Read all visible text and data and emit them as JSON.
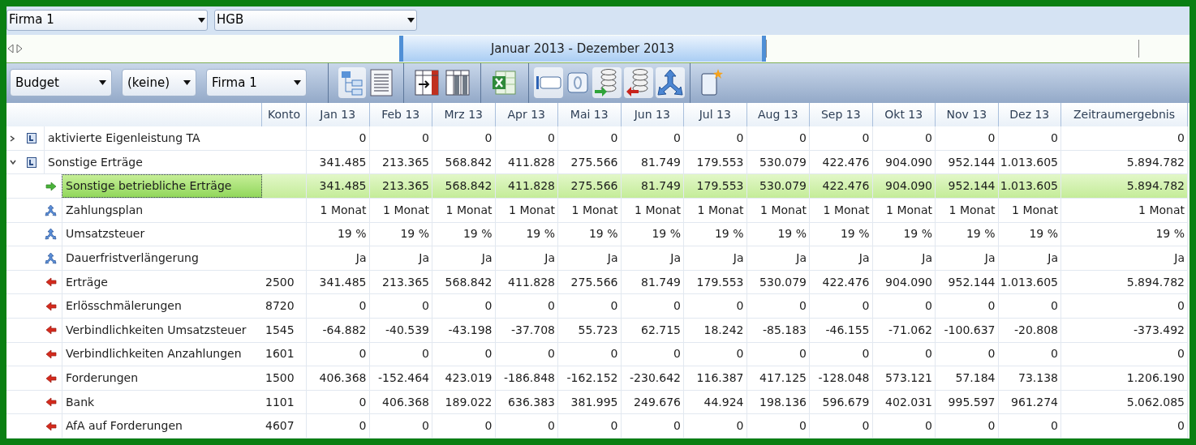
{
  "top_selects": [
    {
      "value": "Firma 1"
    },
    {
      "value": "HGB"
    }
  ],
  "timeline": {
    "range_label": "Januar 2013 - Dezember 2013"
  },
  "filters": [
    {
      "value": "Budget"
    },
    {
      "value": "(keine)"
    },
    {
      "value": "Firma 1"
    }
  ],
  "table": {
    "columns": [
      "Konto",
      "Jan 13",
      "Feb 13",
      "Mrz 13",
      "Apr 13",
      "Mai 13",
      "Jun 13",
      "Jul 13",
      "Aug 13",
      "Sep 13",
      "Okt 13",
      "Nov 13",
      "Dez 13",
      "Zeitraumergebnis"
    ],
    "rows": [
      {
        "kind": "group",
        "name": "aktivierte Eigenleistung TA",
        "expanded": false,
        "selected": false,
        "values": [
          "0",
          "0",
          "0",
          "0",
          "0",
          "0",
          "0",
          "0",
          "0",
          "0",
          "0",
          "0"
        ],
        "total": "0"
      },
      {
        "kind": "group",
        "name": "Sonstige Erträge",
        "expanded": true,
        "selected": false,
        "values": [
          "341.485",
          "213.365",
          "568.842",
          "411.828",
          "275.566",
          "81.749",
          "179.553",
          "530.079",
          "422.476",
          "904.090",
          "952.144",
          "1.013.605"
        ],
        "total": "5.894.782",
        "children": [
          {
            "kind": "income",
            "name": "Sonstige betriebliche Erträge",
            "selected": true,
            "values": [
              "341.485",
              "213.365",
              "568.842",
              "411.828",
              "275.566",
              "81.749",
              "179.553",
              "530.079",
              "422.476",
              "904.090",
              "952.144",
              "1.013.605"
            ],
            "total": "5.894.782"
          },
          {
            "kind": "param",
            "name": "Zahlungsplan",
            "selected": false,
            "values": [
              "1 Monat",
              "1 Monat",
              "1 Monat",
              "1 Monat",
              "1 Monat",
              "1 Monat",
              "1 Monat",
              "1 Monat",
              "1 Monat",
              "1 Monat",
              "1 Monat",
              "1 Monat"
            ],
            "total": "1 Monat"
          },
          {
            "kind": "param",
            "name": "Umsatzsteuer",
            "selected": false,
            "values": [
              "19 %",
              "19 %",
              "19 %",
              "19 %",
              "19 %",
              "19 %",
              "19 %",
              "19 %",
              "19 %",
              "19 %",
              "19 %",
              "19 %"
            ],
            "total": "19 %"
          },
          {
            "kind": "param",
            "name": "Dauerfristverlängerung",
            "selected": false,
            "values": [
              "Ja",
              "Ja",
              "Ja",
              "Ja",
              "Ja",
              "Ja",
              "Ja",
              "Ja",
              "Ja",
              "Ja",
              "Ja",
              "Ja"
            ],
            "total": "Ja"
          },
          {
            "kind": "account",
            "name": "Erträge",
            "selected": false,
            "konto": "2500",
            "values": [
              "341.485",
              "213.365",
              "568.842",
              "411.828",
              "275.566",
              "81.749",
              "179.553",
              "530.079",
              "422.476",
              "904.090",
              "952.144",
              "1.013.605"
            ],
            "total": "5.894.782"
          },
          {
            "kind": "account",
            "name": "Erlösschmälerungen",
            "selected": false,
            "konto": "8720",
            "values": [
              "0",
              "0",
              "0",
              "0",
              "0",
              "0",
              "0",
              "0",
              "0",
              "0",
              "0",
              "0"
            ],
            "total": "0"
          },
          {
            "kind": "account",
            "name": "Verbindlichkeiten Umsatzsteuer",
            "selected": false,
            "konto": "1545",
            "values": [
              "-64.882",
              "-40.539",
              "-43.198",
              "-37.708",
              "55.723",
              "62.715",
              "18.242",
              "-85.183",
              "-46.155",
              "-71.062",
              "-100.637",
              "-20.808"
            ],
            "total": "-373.492"
          },
          {
            "kind": "account",
            "name": "Verbindlichkeiten Anzahlungen",
            "selected": false,
            "konto": "1601",
            "values": [
              "0",
              "0",
              "0",
              "0",
              "0",
              "0",
              "0",
              "0",
              "0",
              "0",
              "0",
              "0"
            ],
            "total": "0"
          },
          {
            "kind": "account",
            "name": "Forderungen",
            "selected": false,
            "konto": "1500",
            "values": [
              "406.368",
              "-152.464",
              "423.019",
              "-186.848",
              "-162.152",
              "-230.642",
              "116.387",
              "417.125",
              "-128.048",
              "573.121",
              "57.184",
              "73.138"
            ],
            "total": "1.206.190"
          },
          {
            "kind": "account",
            "name": "Bank",
            "selected": false,
            "konto": "1101",
            "values": [
              "0",
              "406.368",
              "189.022",
              "636.383",
              "381.995",
              "249.676",
              "44.924",
              "198.136",
              "596.679",
              "402.031",
              "995.597",
              "961.274"
            ],
            "total": "5.062.085"
          },
          {
            "kind": "account",
            "name": "AfA auf Forderungen",
            "selected": false,
            "konto": "4607",
            "values": [
              "0",
              "0",
              "0",
              "0",
              "0",
              "0",
              "0",
              "0",
              "0",
              "0",
              "0",
              "0"
            ],
            "total": "0"
          }
        ]
      }
    ]
  }
}
